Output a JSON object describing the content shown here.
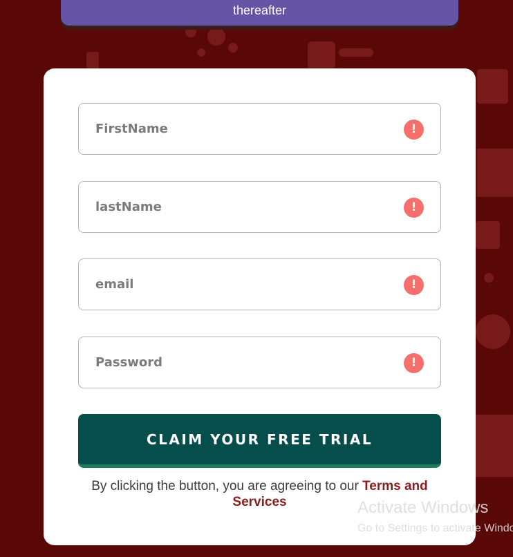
{
  "banner": {
    "text": "thereafter"
  },
  "form": {
    "fields": [
      {
        "name": "firstname",
        "placeholder": "FirstName",
        "value": ""
      },
      {
        "name": "lastname",
        "placeholder": "lastName",
        "value": ""
      },
      {
        "name": "email",
        "placeholder": "email",
        "value": ""
      },
      {
        "name": "password",
        "placeholder": "Password",
        "value": ""
      }
    ],
    "alert_glyph": "!",
    "submit_label": "CLAIM YOUR FREE TRIAL",
    "agreement_prefix": "By clicking the button, you are agreeing to our ",
    "agreement_link": "Terms and Services"
  },
  "watermark": {
    "title": "Activate Windows",
    "subtitle": "Go to Settings to activate Windows."
  },
  "icons": {
    "field_alert": "exclamation-circle-icon"
  },
  "colors": {
    "background": "#5a0708",
    "banner": "#6354a6",
    "card": "#ffffff",
    "alert": "#f5706c",
    "cta": "#064e4c",
    "cta_border": "#1f7a5c",
    "link": "#8c1c1c"
  }
}
